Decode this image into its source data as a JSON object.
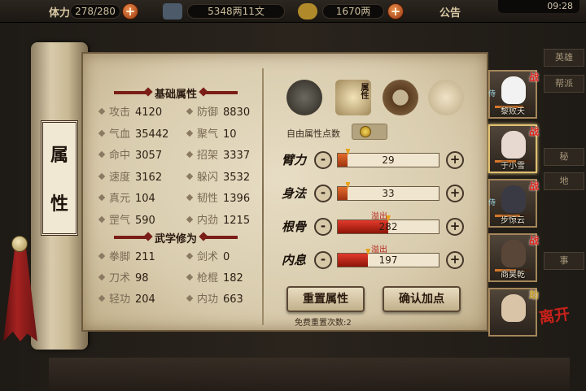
{
  "topbar": {
    "stamina_label": "体力",
    "stamina_value": "278/280",
    "silver_value": "5348两11文",
    "gold_value": "1670两",
    "notice_label": "公告",
    "time": "09:28",
    "plus_label": "+"
  },
  "right_tabs": [
    "英雄",
    "帮派",
    "秘",
    "地",
    "事"
  ],
  "scroll": {
    "char1": "属",
    "char2": "性"
  },
  "basic": {
    "title": "基础属性",
    "stats": [
      {
        "name": "攻击",
        "value": "4120"
      },
      {
        "name": "防御",
        "value": "8830"
      },
      {
        "name": "气血",
        "value": "35442"
      },
      {
        "name": "聚气",
        "value": "10"
      },
      {
        "name": "命中",
        "value": "3057"
      },
      {
        "name": "招架",
        "value": "3337"
      },
      {
        "name": "速度",
        "value": "3162"
      },
      {
        "name": "躲闪",
        "value": "3532"
      },
      {
        "name": "真元",
        "value": "104"
      },
      {
        "name": "韧性",
        "value": "1396"
      },
      {
        "name": "罡气",
        "value": "590"
      },
      {
        "name": "内劲",
        "value": "1215"
      }
    ]
  },
  "martial": {
    "title": "武学修为",
    "stats": [
      {
        "name": "拳脚",
        "value": "211"
      },
      {
        "name": "剑术",
        "value": "0"
      },
      {
        "name": "刀术",
        "value": "98"
      },
      {
        "name": "枪棍",
        "value": "182"
      },
      {
        "name": "轻功",
        "value": "204"
      },
      {
        "name": "内功",
        "value": "663"
      }
    ]
  },
  "panel": {
    "tab_active_label": "属性",
    "free_points_label": "自由属性点数",
    "overflow_label": "溢出",
    "minus": "-",
    "plus": "+",
    "attrs": [
      {
        "name": "臂力",
        "value": "29",
        "fraction": 0.1,
        "overflow": false
      },
      {
        "name": "身法",
        "value": "33",
        "fraction": 0.1,
        "overflow": false
      },
      {
        "name": "根骨",
        "value": "282",
        "fraction": 0.5,
        "overflow": true
      },
      {
        "name": "内息",
        "value": "197",
        "fraction": 0.3,
        "overflow": true
      }
    ],
    "reset_button": "重置属性",
    "confirm_button": "确认加点",
    "reset_note": "免费重置次数:2"
  },
  "heroes": [
    {
      "name": "黎败天",
      "tag": "战",
      "hp": 0.8,
      "mark": "侍"
    },
    {
      "name": "于小雪",
      "tag": "战",
      "hp": 0.6,
      "mark": ""
    },
    {
      "name": "步惊云",
      "tag": "战",
      "hp": 0.7,
      "mark": "侍"
    },
    {
      "name": "商昊乾",
      "tag": "战",
      "hp": 0.6,
      "mark": ""
    },
    {
      "name": "",
      "tag": "助",
      "hp": 0,
      "mark": ""
    }
  ],
  "leave_label": "离开",
  "colors": {
    "accent_red": "#7a1d17",
    "bar_orange": "#e36c2c",
    "overflow_red": "#b5241a"
  }
}
